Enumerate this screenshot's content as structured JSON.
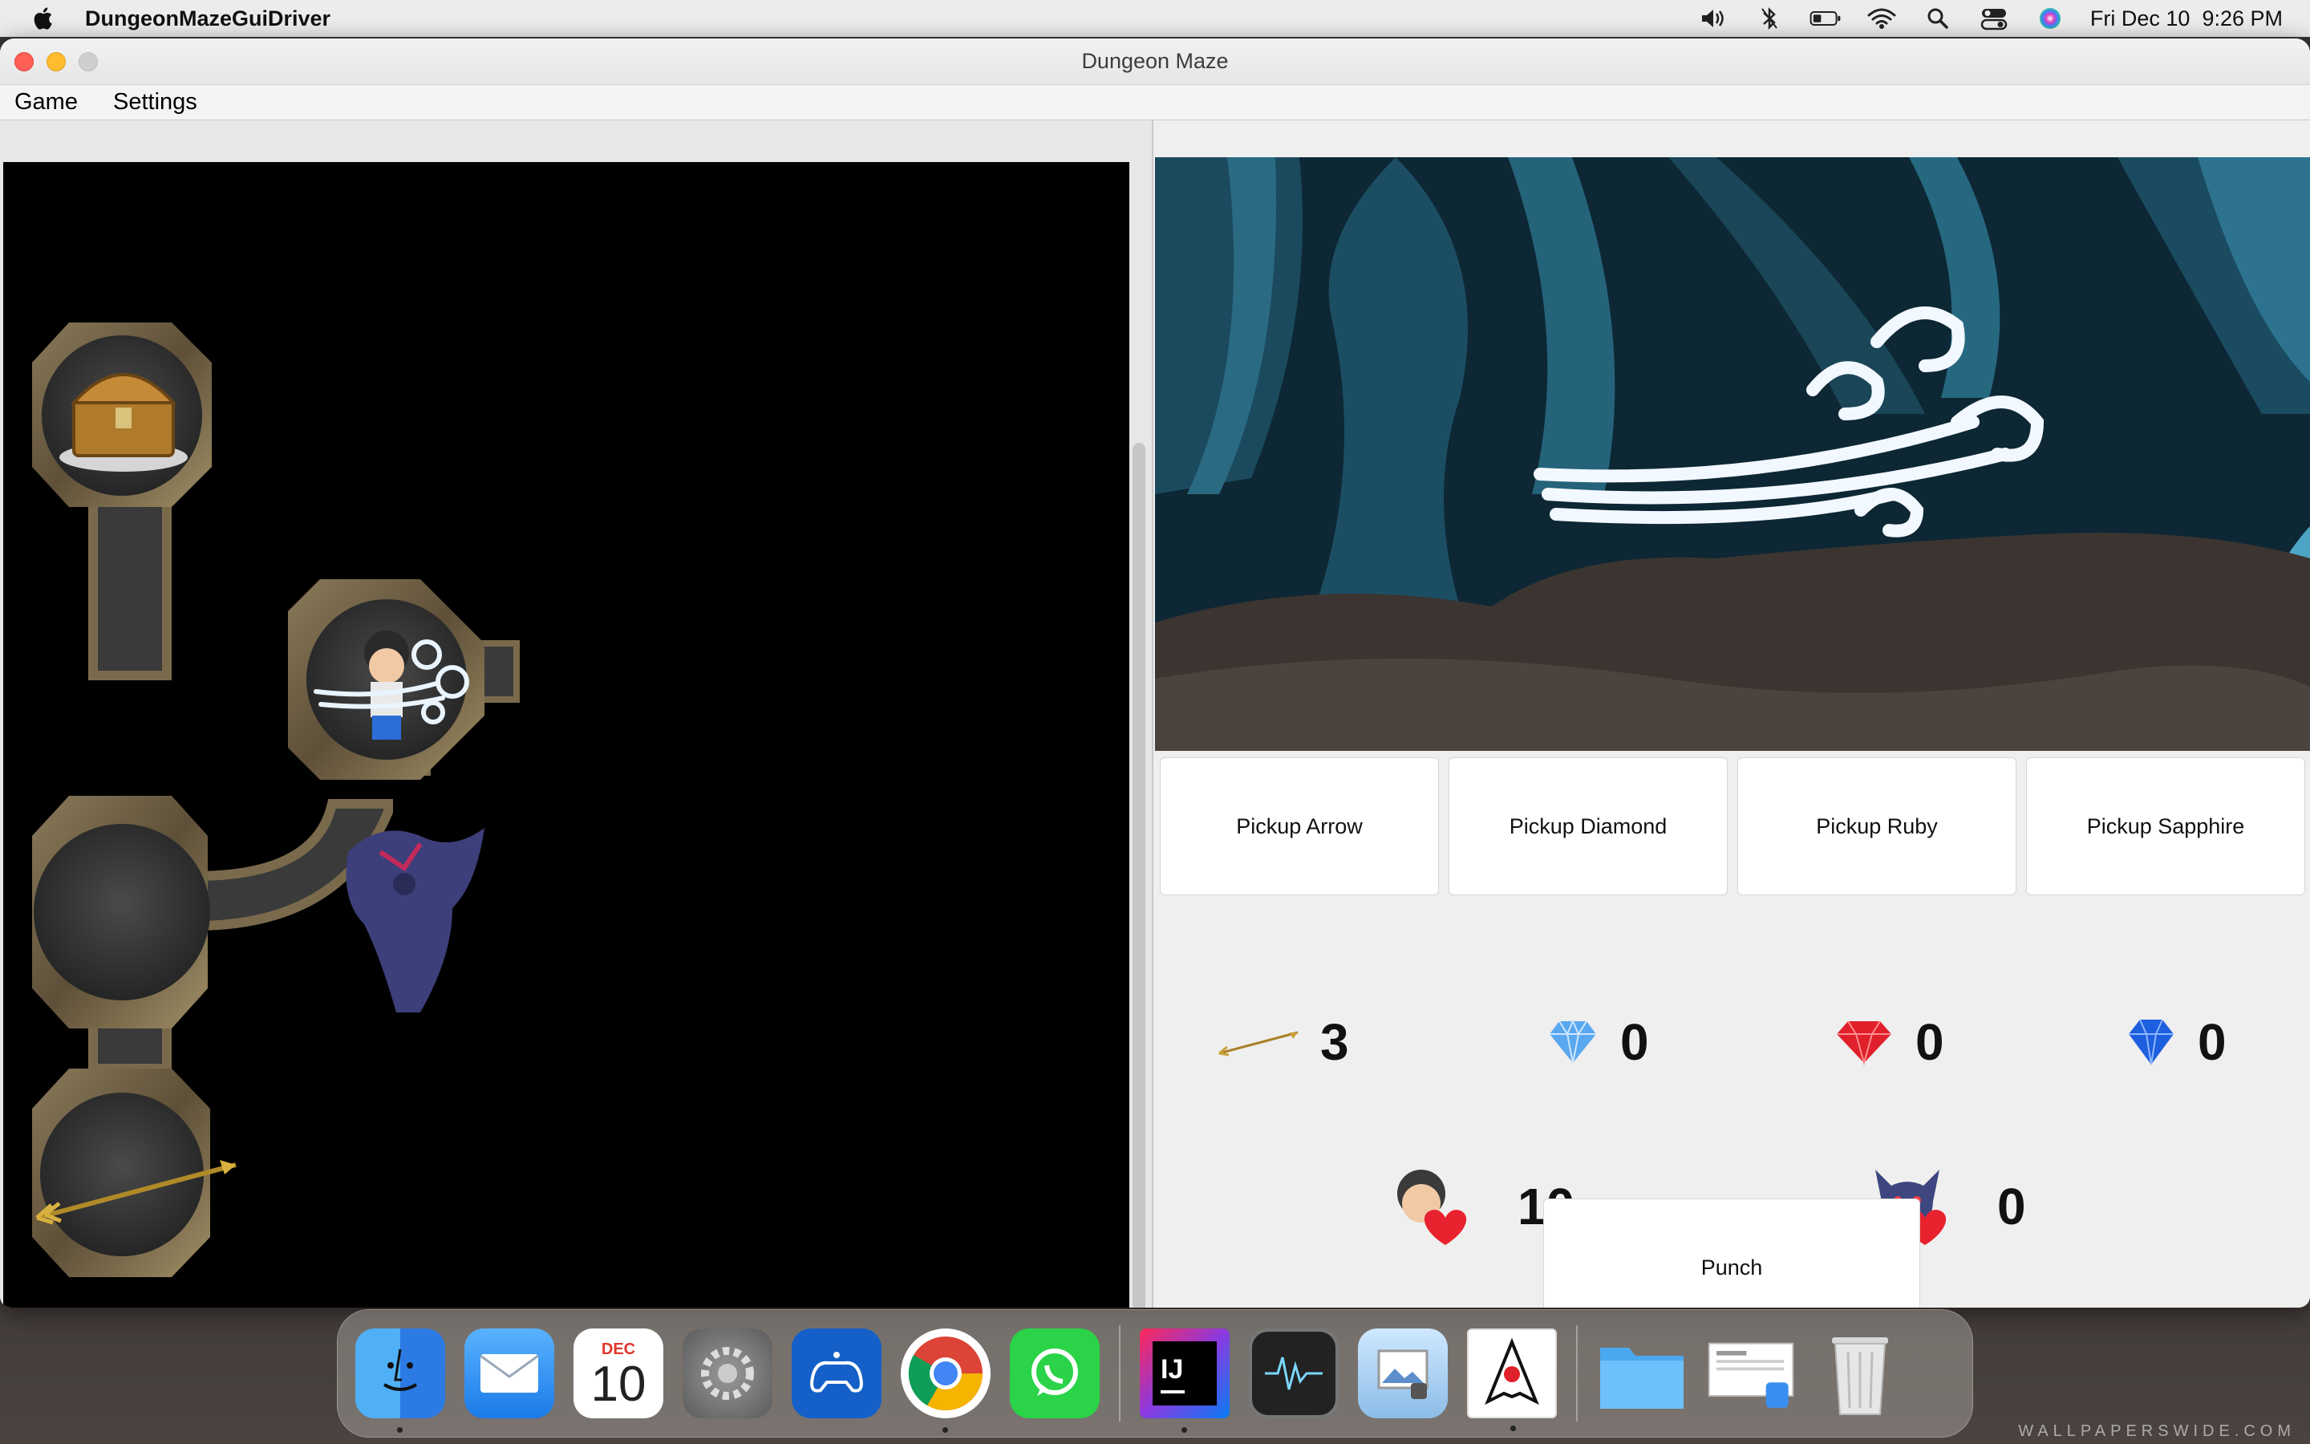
{
  "menubar": {
    "app_name": "DungeonMazeGuiDriver",
    "clock": "Fri Dec 10  9:26 PM"
  },
  "window": {
    "title": "Dungeon Maze",
    "menus": [
      "Game",
      "Settings"
    ]
  },
  "pickup_buttons": [
    "Pickup Arrow",
    "Pickup Diamond",
    "Pickup Ruby",
    "Pickup Sapphire"
  ],
  "inventory": {
    "arrows": "3",
    "diamonds": "0",
    "rubies": "0",
    "sapphires": "0"
  },
  "health": {
    "player": "10",
    "monster": "0"
  },
  "punch_label": "Punch",
  "dock": {
    "calendar_month": "DEC",
    "calendar_day": "10",
    "ide_label": "IJ"
  },
  "watermark": "WALLPAPERSWIDE.COM",
  "colors": {
    "diamond": "#5aa8f0",
    "ruby": "#e0202a",
    "sapphire": "#1e5fe0",
    "heart": "#e8222e",
    "cave_dark": "#0d2734",
    "cave_floor": "#3b3430"
  }
}
